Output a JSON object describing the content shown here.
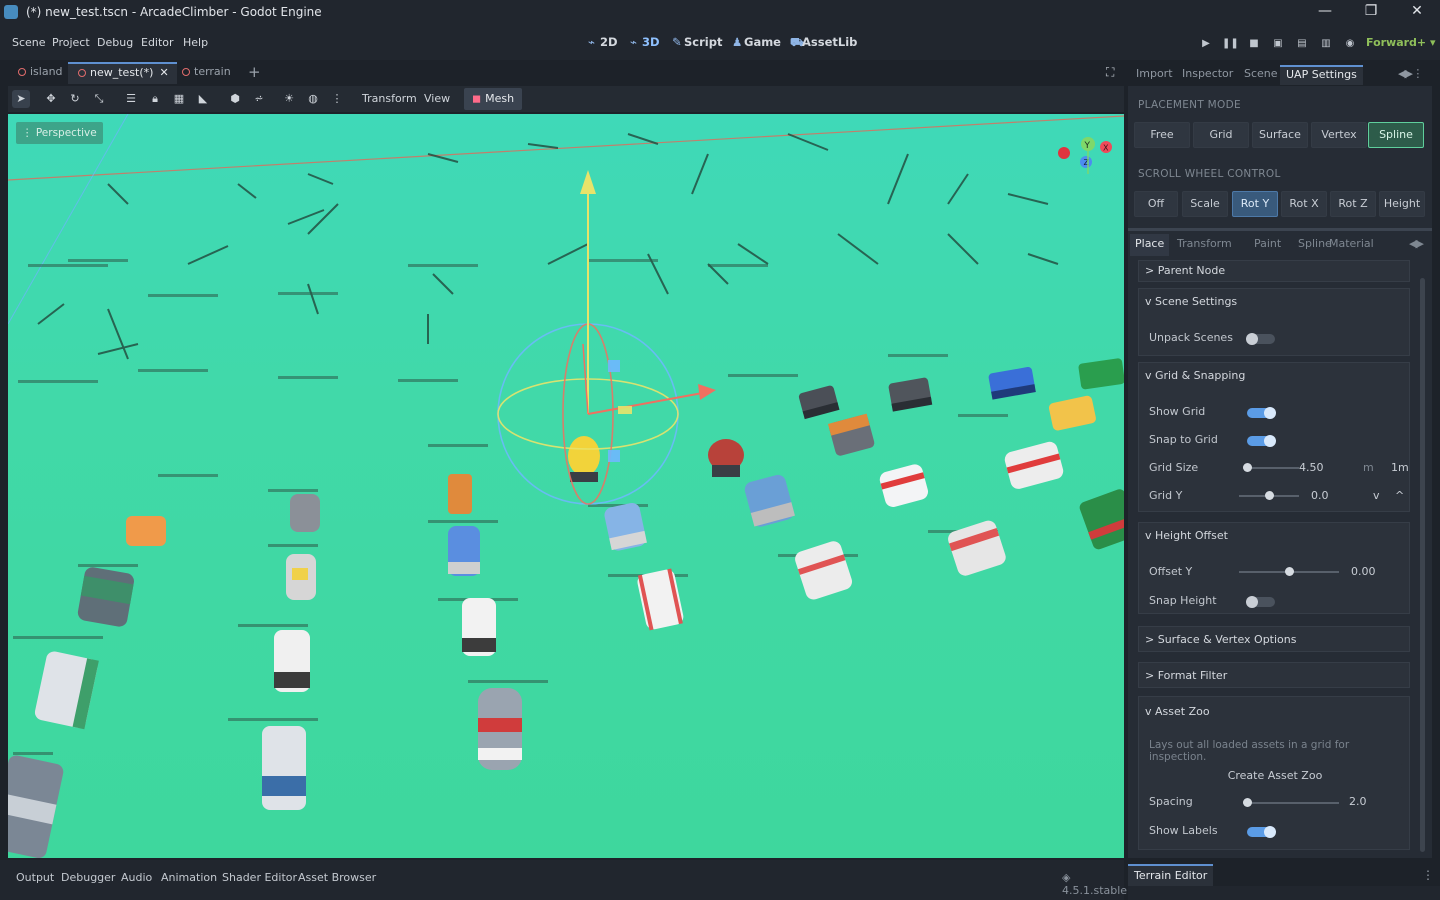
{
  "window": {
    "title": "(*) new_test.tscn - ArcadeClimber - Godot Engine",
    "minimize": "—",
    "maximize": "❐",
    "close": "✕"
  },
  "menu": [
    "Scene",
    "Project",
    "Debug",
    "Editor",
    "Help"
  ],
  "main_screens": [
    {
      "icon": "2d-icon",
      "label": "2D"
    },
    {
      "icon": "3d-icon",
      "label": "3D"
    },
    {
      "icon": "script-icon",
      "label": "Script"
    },
    {
      "icon": "game-icon",
      "label": "Game"
    },
    {
      "icon": "assetlib-icon",
      "label": "AssetLib"
    }
  ],
  "renderer": "Forward+",
  "scene_tabs": [
    {
      "label": "island",
      "active": false
    },
    {
      "label": "new_test(*)",
      "active": true
    },
    {
      "label": "terrain",
      "active": false
    }
  ],
  "toolbar": {
    "transform_label": "Transform",
    "view_label": "View",
    "mesh_label": "Mesh"
  },
  "viewport": {
    "perspective_label": "Perspective",
    "gizmo_axes": [
      "Y",
      "X",
      "Z"
    ]
  },
  "dock_tabs": [
    "Import",
    "Inspector",
    "Scene",
    "UAP Settings"
  ],
  "uap": {
    "placement_mode_label": "PLACEMENT MODE",
    "placement_modes": [
      "Free",
      "Grid",
      "Surface",
      "Vertex",
      "Spline"
    ],
    "placement_selected": "Spline",
    "scroll_wheel_label": "SCROLL WHEEL CONTROL",
    "scroll_modes": [
      "Off",
      "Scale",
      "Rot Y",
      "Rot X",
      "Rot Z",
      "Height"
    ],
    "scroll_selected": "Rot Y",
    "sub_tabs": [
      "Place",
      "Transform",
      "Paint",
      "Spline",
      "Material"
    ],
    "sub_tab_selected": "Place",
    "parent_node": "> Parent Node",
    "scene_settings": {
      "header": "v Scene Settings",
      "unpack_label": "Unpack Scenes",
      "unpack_on": false
    },
    "grid_snapping": {
      "header": "v Grid & Snapping",
      "show_grid_label": "Show Grid",
      "show_grid_on": true,
      "snap_label": "Snap to Grid",
      "snap_on": true,
      "grid_size_label": "Grid Size",
      "grid_size_value": "4.50",
      "grid_size_unit": "m",
      "grid_size_preset": "1m",
      "grid_y_label": "Grid Y",
      "grid_y_value": "0.0",
      "grid_y_down": "v",
      "grid_y_up": "^"
    },
    "height_offset": {
      "header": "v Height Offset",
      "offset_label": "Offset Y",
      "offset_value": "0.00",
      "snap_height_label": "Snap Height",
      "snap_height_on": false
    },
    "surface_vertex": "> Surface & Vertex Options",
    "format_filter": "> Format Filter",
    "asset_zoo": {
      "header": "v Asset Zoo",
      "hint": "Lays out all loaded assets in a grid for inspection.",
      "create_button": "Create Asset Zoo",
      "spacing_label": "Spacing",
      "spacing_value": "2.0",
      "show_labels_label": "Show Labels",
      "show_labels_on": true
    }
  },
  "bottom_panel": [
    "Output",
    "Debugger",
    "Audio",
    "Animation",
    "Shader Editor",
    "Asset Browser"
  ],
  "version": "4.5.1.stable",
  "terrain_editor_tab": "Terrain Editor",
  "colors": {
    "accent": "#5f90d0",
    "viewport_ground": "#3ed79d",
    "toggle_on": "#5b9ce6",
    "spline_selected": "#5fcf9c",
    "renderer_green": "#8fbf5a"
  }
}
